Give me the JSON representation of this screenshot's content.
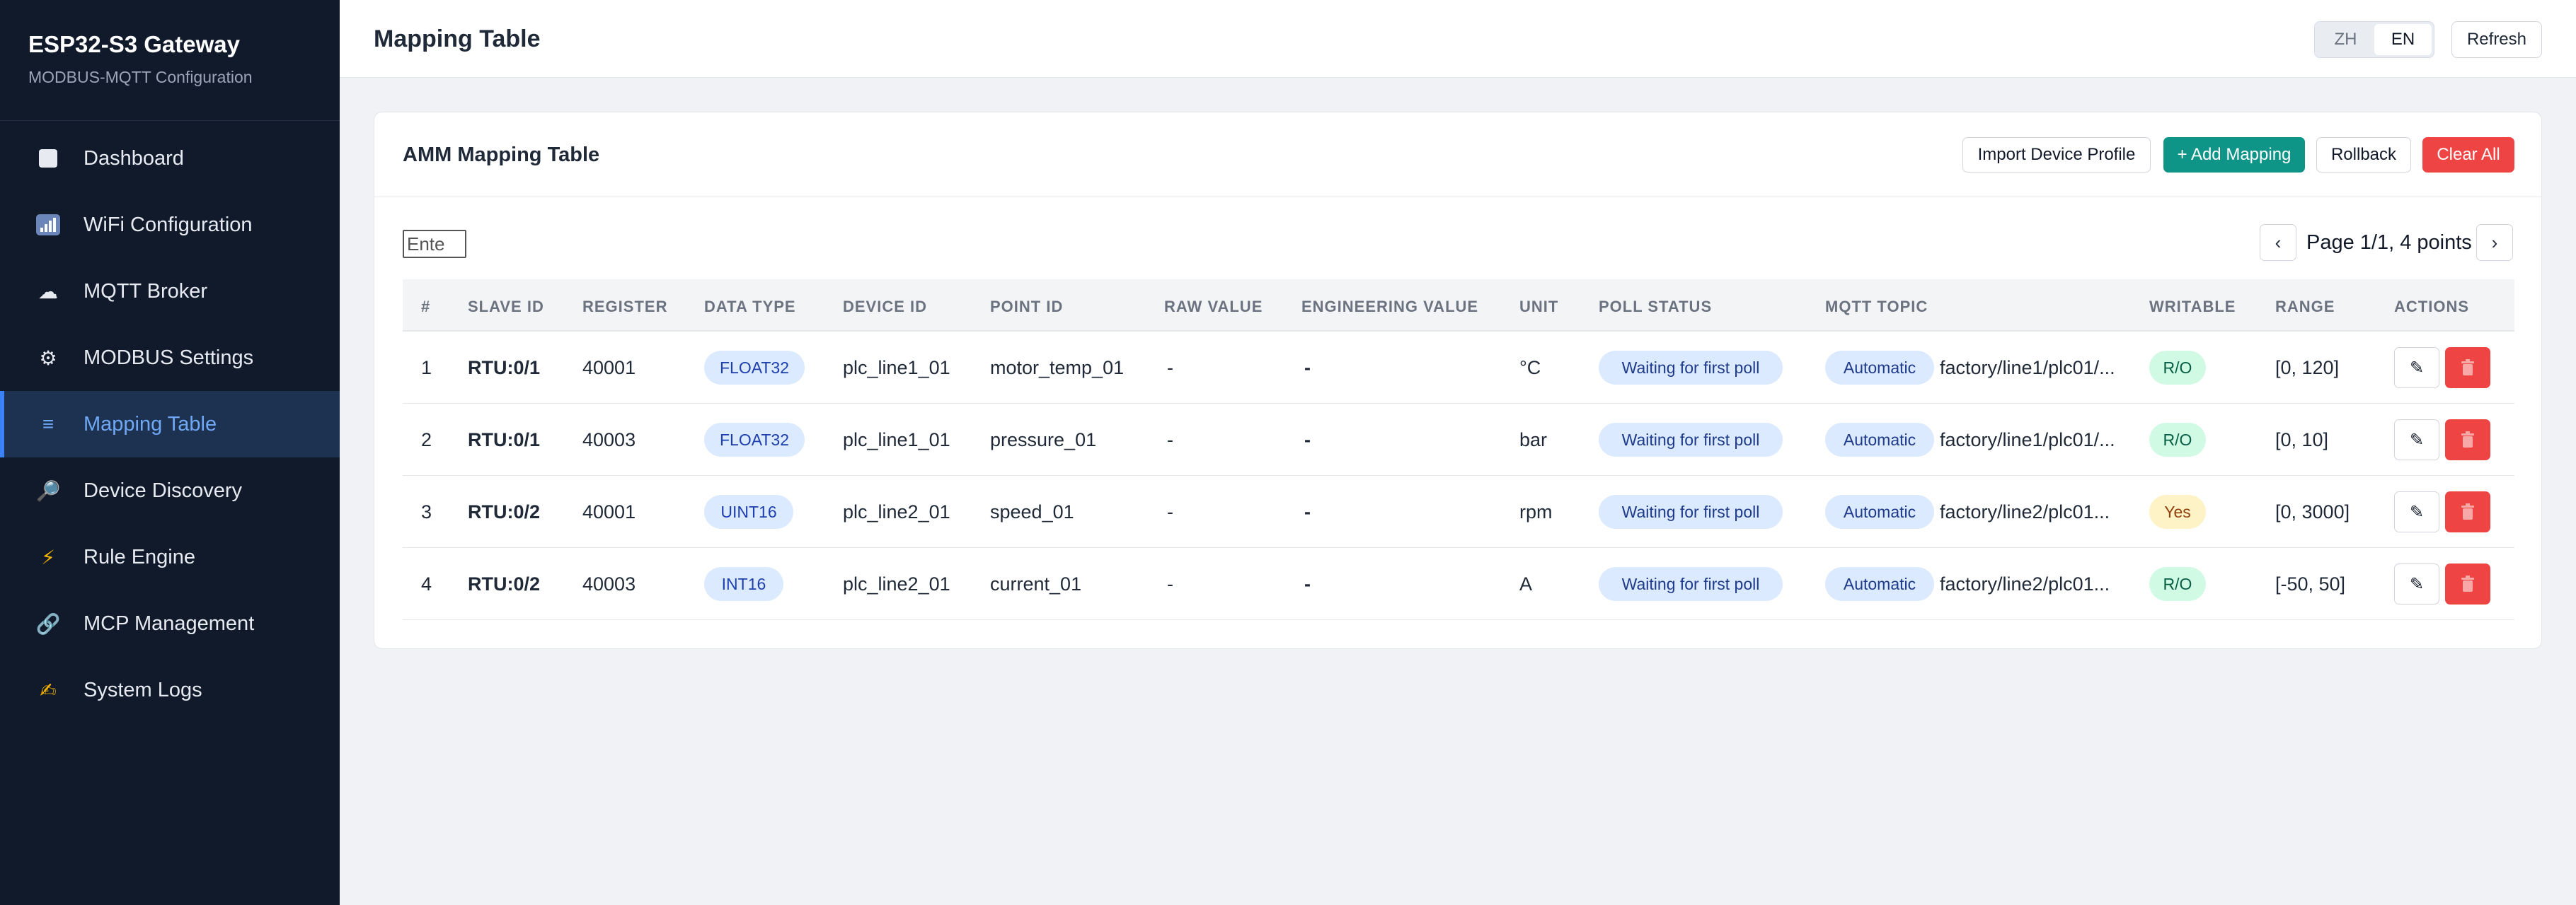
{
  "sidebar": {
    "brand_title": "ESP32-S3 Gateway",
    "brand_subtitle": "MODBUS-MQTT Configuration",
    "items": [
      {
        "label": "Dashboard",
        "icon": "square-icon",
        "glyph": ""
      },
      {
        "label": "WiFi Configuration",
        "icon": "signal-bars-icon",
        "glyph": ""
      },
      {
        "label": "MQTT Broker",
        "icon": "cloud-icon",
        "glyph": "☁"
      },
      {
        "label": "MODBUS Settings",
        "icon": "gear-icon",
        "glyph": "⚙"
      },
      {
        "label": "Mapping Table",
        "icon": "list-icon",
        "glyph": "≡",
        "active": true
      },
      {
        "label": "Device Discovery",
        "icon": "magnifier-icon",
        "glyph": "🔎"
      },
      {
        "label": "Rule Engine",
        "icon": "lightning-icon",
        "glyph": "⚡"
      },
      {
        "label": "MCP Management",
        "icon": "link-icon",
        "glyph": "🔗"
      },
      {
        "label": "System Logs",
        "icon": "writing-hand-icon",
        "glyph": "✍"
      }
    ]
  },
  "header": {
    "title": "Mapping Table",
    "lang_zh": "ZH",
    "lang_en": "EN",
    "active_lang": "EN",
    "refresh_label": "Refresh"
  },
  "card": {
    "title": "AMM Mapping Table",
    "import_label": "Import Device Profile",
    "add_label": "+ Add Mapping",
    "rollback_label": "Rollback",
    "clear_label": "Clear All",
    "filter_placeholder": "Ente",
    "pager_prev": "‹",
    "pager_next": "›",
    "pager_text": "Page 1/1, 4 points"
  },
  "table": {
    "headers": [
      "#",
      "SLAVE ID",
      "REGISTER",
      "DATA TYPE",
      "DEVICE ID",
      "POINT ID",
      "RAW VALUE",
      "ENGINEERING VALUE",
      "UNIT",
      "POLL STATUS",
      "MQTT TOPIC",
      "WRITABLE",
      "RANGE",
      "ACTIONS"
    ],
    "rows": [
      {
        "num": "1",
        "slave": "RTU:0/1",
        "register": "40001",
        "dtype": "FLOAT32",
        "device": "plc_line1_01",
        "point": "motor_temp_01",
        "raw": "-",
        "eng": "-",
        "unit": "°C",
        "status": "Waiting for first poll",
        "mode": "Automatic",
        "topic": "factory/line1/plc01/...",
        "writable": "R/O",
        "range": "[0, 120]",
        "edit": "✎"
      },
      {
        "num": "2",
        "slave": "RTU:0/1",
        "register": "40003",
        "dtype": "FLOAT32",
        "device": "plc_line1_01",
        "point": "pressure_01",
        "raw": "-",
        "eng": "-",
        "unit": "bar",
        "status": "Waiting for first poll",
        "mode": "Automatic",
        "topic": "factory/line1/plc01/...",
        "writable": "R/O",
        "range": "[0, 10]",
        "edit": "✎"
      },
      {
        "num": "3",
        "slave": "RTU:0/2",
        "register": "40001",
        "dtype": "UINT16",
        "device": "plc_line2_01",
        "point": "speed_01",
        "raw": "-",
        "eng": "-",
        "unit": "rpm",
        "status": "Waiting for first poll",
        "mode": "Automatic",
        "topic": "factory/line2/plc01...",
        "writable": "Yes",
        "range": "[0, 3000]",
        "edit": "✎"
      },
      {
        "num": "4",
        "slave": "RTU:0/2",
        "register": "40003",
        "dtype": "INT16",
        "device": "plc_line2_01",
        "point": "current_01",
        "raw": "-",
        "eng": "-",
        "unit": "A",
        "status": "Waiting for first poll",
        "mode": "Automatic",
        "topic": "factory/line2/plc01...",
        "writable": "R/O",
        "range": "[-50, 50]",
        "edit": "✎"
      }
    ]
  },
  "colors": {
    "sidebar_bg": "#111a2b",
    "accent": "#3b82f6",
    "primary_action": "#0f9488",
    "danger": "#ef4444"
  }
}
